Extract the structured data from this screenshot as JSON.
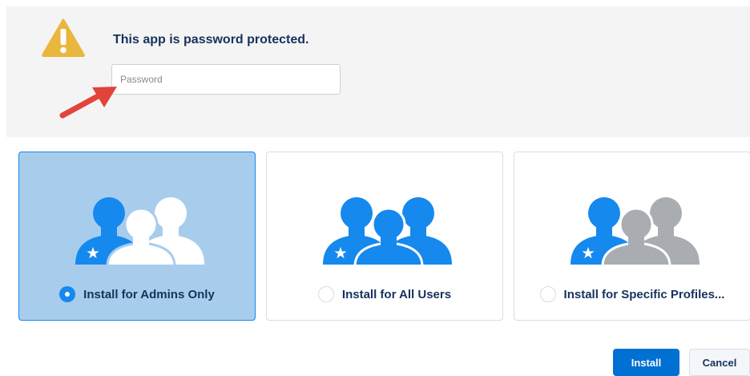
{
  "password_section": {
    "title": "This app is password protected.",
    "placeholder": "Password",
    "value": "",
    "icon": "warning-icon",
    "annotation": "red-arrow"
  },
  "install_options": [
    {
      "label": "Install for Admins Only",
      "selected": true,
      "icon": "admin-users-icon"
    },
    {
      "label": "Install for All Users",
      "selected": false,
      "icon": "all-users-icon"
    },
    {
      "label": "Install for Specific Profiles...",
      "selected": false,
      "icon": "specific-profiles-icon"
    }
  ],
  "buttons": {
    "install": "Install",
    "cancel": "Cancel"
  },
  "colors": {
    "brand_blue": "#1589ee",
    "selected_bg": "#a8cdec",
    "warning": "#e9b63e",
    "arrow": "#e3433a",
    "gray_user": "#a9adb1",
    "text_dark": "#16325c"
  }
}
